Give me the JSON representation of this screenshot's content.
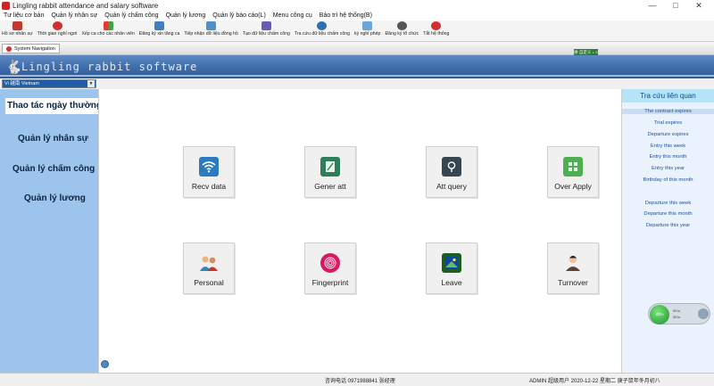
{
  "window": {
    "title": "Lingling rabbit attendance and salary software"
  },
  "menubar": {
    "items": [
      "Tư liệu cơ bản",
      "Quản lý nhân sự",
      "Quản lý chấm công",
      "Quản lý lương",
      "Quản lý báo cáo(L)",
      "Menu công cụ",
      "Bảo trì hệ thống(B)"
    ]
  },
  "toolbar": {
    "items": [
      {
        "label": "Hồ sơ nhân sự",
        "color": "#c0392b"
      },
      {
        "label": "Thời gian nghỉ ngơi",
        "color": "#d32f2f"
      },
      {
        "label": "Xếp ca cho các nhân viên",
        "color": "#6d9f3b"
      },
      {
        "label": "Đăng ký xin tăng ca",
        "color": "#3f7fc0"
      },
      {
        "label": "Tiếp nhận dữ liệu đồng hồ",
        "color": "#4f90c8"
      },
      {
        "label": "Tạo dữ liệu chấm công",
        "color": "#6a5bb5"
      },
      {
        "label": "Tra cứu dữ liệu chấm công",
        "color": "#2d6eb5"
      },
      {
        "label": "ký nghỉ phép",
        "color": "#6aa7d8"
      },
      {
        "label": "Đăng ký tổ chức",
        "color": "#555555"
      },
      {
        "label": "Tắt hệ thống",
        "color": "#d32f2f"
      }
    ]
  },
  "navstrip": {
    "tab_label": "System Navigation",
    "ime": "拼 自定义 ♪ ≡"
  },
  "banner": {
    "brand": "Lingling rabbit software",
    "rabbit_icon": "rabbit-icon"
  },
  "language": {
    "selected": "Vi 越南 Vietnam"
  },
  "left_nav": {
    "items": [
      {
        "label": "Thao tác ngày thường"
      },
      {
        "label": "Quản lý nhân sự"
      },
      {
        "label": "Quản lý chấm công"
      },
      {
        "label": "Quản lý lương"
      }
    ]
  },
  "tiles": [
    {
      "label": "Recv data",
      "icon": "wifi-icon",
      "color": "#2a7bbf"
    },
    {
      "label": "Gener att",
      "icon": "document-icon",
      "color": "#2e7d5b"
    },
    {
      "label": "Att query",
      "icon": "magnifier-icon",
      "color": "#37474f"
    },
    {
      "label": "Over Apply",
      "icon": "calculator-icon",
      "color": "#4caf50"
    },
    {
      "label": "Personal",
      "icon": "people-icon",
      "color": "#4a7fbf"
    },
    {
      "label": "Fingerprint",
      "icon": "fingerprint-icon",
      "color": "#d81b60"
    },
    {
      "label": "Leave",
      "icon": "leave-icon",
      "color": "#1b5e20"
    },
    {
      "label": "Turnover",
      "icon": "person-icon",
      "color": "#5d4037"
    }
  ],
  "right_panel": {
    "title": "Tra cứu liên quan",
    "links": [
      "The contract expires",
      "Trial expires",
      "Departure expires",
      "Entry this week",
      "Entry this month",
      "Entry this year",
      "Birthday of this month",
      "Departure this week",
      "Departure this month",
      "Departure this year"
    ],
    "gadget": {
      "ball": "43%",
      "row1": "0K/s",
      "row2": "0K/s"
    }
  },
  "statusbar": {
    "phone": "咨询电话 0971988841 张经理",
    "user": "ADMIN 超级用户 2020-12-22 星期二 庚子鼠年冬月初八"
  }
}
